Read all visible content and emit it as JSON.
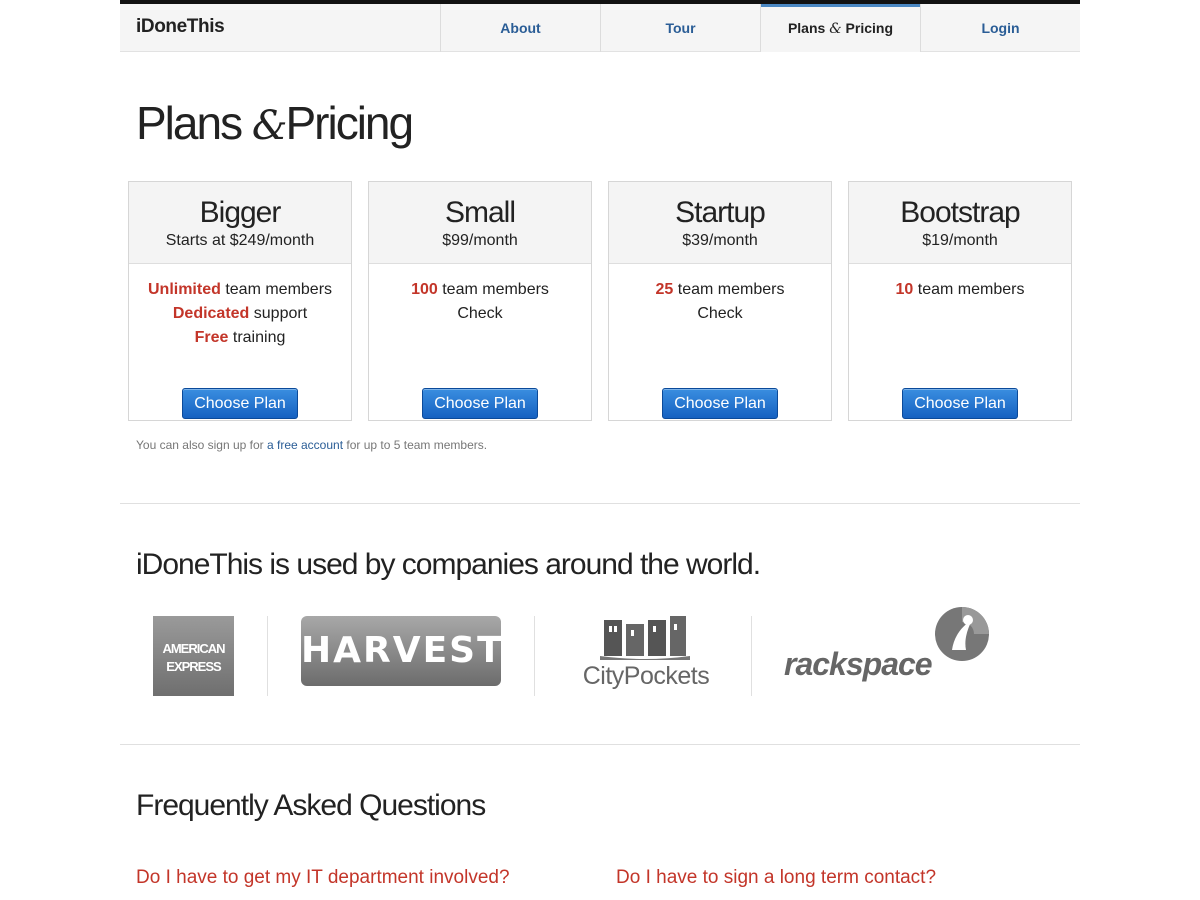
{
  "brand": "iDoneThis",
  "nav": {
    "about": "About",
    "tour": "Tour",
    "plans_pre": "Plans ",
    "plans_amp": "&",
    "plans_post": " Pricing",
    "login": "Login"
  },
  "page": {
    "title_pre": "Plans ",
    "title_amp": "&",
    "title_post": "Pricing"
  },
  "plans": [
    {
      "name": "Bigger",
      "price": "Starts at $249/month",
      "features": [
        {
          "hl": "Unlimited",
          "text": " team members"
        },
        {
          "hl": "Dedicated",
          "text": " support"
        },
        {
          "hl": "Free",
          "text": " training"
        }
      ],
      "button": "Choose Plan"
    },
    {
      "name": "Small",
      "price": "$99/month",
      "features": [
        {
          "hl": "100",
          "text": " team members"
        },
        {
          "hl": "",
          "text": "Check"
        }
      ],
      "button": "Choose Plan"
    },
    {
      "name": "Startup",
      "price": "$39/month",
      "features": [
        {
          "hl": "25",
          "text": " team members"
        },
        {
          "hl": "",
          "text": "Check"
        }
      ],
      "button": "Choose Plan"
    },
    {
      "name": "Bootstrap",
      "price": "$19/month",
      "features": [
        {
          "hl": "10",
          "text": " team members"
        }
      ],
      "button": "Choose Plan"
    }
  ],
  "note": {
    "pre": "You can also sign up for ",
    "link": "a free account",
    "post": " for up to 5 team members."
  },
  "companies": {
    "title": "iDoneThis is used by companies around the world.",
    "logos": {
      "amex_line1": "AMERICAN",
      "amex_line2": "EXPRESS",
      "harvest": "HARVEST",
      "citypockets": "CityPockets",
      "rackspace": "rackspace"
    }
  },
  "faq": {
    "title": "Frequently Asked Questions",
    "q1": "Do I have to get my IT department involved?",
    "q2": "Do I have to sign a long term contact?"
  },
  "colors": {
    "highlight": "#c33529",
    "link": "#2a5d96",
    "button": "#1f6fd0"
  }
}
